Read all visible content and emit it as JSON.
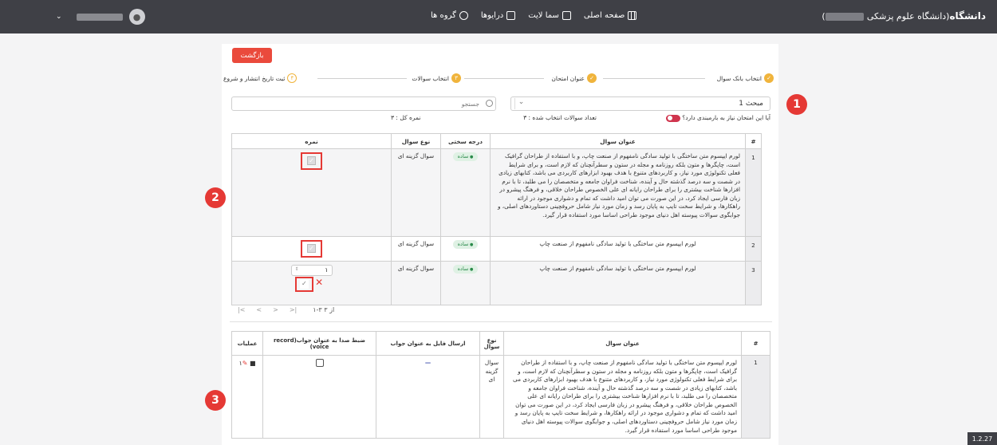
{
  "header": {
    "brand": "دانشگاه",
    "brand_sub": "(دانشگاه علوم پزشکی",
    "brand_close": ")",
    "nav": [
      {
        "label": "صفحه اصلی",
        "icon": "grid-icon"
      },
      {
        "label": "سما لایت",
        "icon": "file-icon"
      },
      {
        "label": "درایوها",
        "icon": "folder-icon"
      },
      {
        "label": "گروه ها",
        "icon": "people-icon"
      }
    ],
    "user_caret": "⌄"
  },
  "back_button": "بازگشت",
  "stepper": [
    {
      "label": "انتخاب بانک سوال",
      "state": "done"
    },
    {
      "label": "عنوان امتحان",
      "state": "done"
    },
    {
      "label": "انتخاب سوالات",
      "state": "current",
      "num": "۳"
    },
    {
      "label": "ثبت تاریخ انتشار و شروع",
      "state": "todo",
      "num": "۴"
    }
  ],
  "topic_select": {
    "value": "مبحث 1"
  },
  "search": {
    "placeholder": "جستجو"
  },
  "info": {
    "needs_scoring": "آیا این امتحان نیاز به بارمبندی دارد؟",
    "selected_count": "تعداد سوالات انتخاب شده : ۳",
    "total_score": "نمره کل : ۳"
  },
  "table1": {
    "headers": [
      "#",
      "عنوان سوال",
      "درجه سختی",
      "نوع سوال",
      "نمره"
    ],
    "rows": [
      {
        "num": "1",
        "title": "لورم ایپسوم متن ساختگی با تولید سادگی نامفهوم از صنعت چاپ، و با استفاده از طراحان گرافیک است، چاپگرها و متون بلکه روزنامه و مجله در ستون و سطرآنچنان که لازم است، و برای شرایط فعلی تکنولوژی مورد نیاز، و کاربردهای متنوع با هدف بهبود ابزارهای کاربردی می باشد، کتابهای زیادی در شصت و سه درصد گذشته حال و آینده، شناخت فراوان جامعه و متخصصان را می طلبد، تا با نرم افزارها شناخت بیشتری را برای طراحان رایانه ای علی الخصوص طراحان خلاقی، و فرهنگ پیشرو در زبان فارسی ایجاد کرد، در این صورت می توان امید داشت که تمام و دشواری موجود در ارائه راهکارها، و شرایط سخت تایپ به پایان رسد و زمان مورد نیاز شامل حروفچینی دستاوردهای اصلی، و جوابگوی سوالات پیوسته اهل دنیای موجود طراحی اساسا مورد استفاده قرار گیرد.",
        "difficulty": "ساده",
        "type": "سوال گزینه ای"
      },
      {
        "num": "2",
        "title": "لورم ایپسوم متن ساختگی با تولید سادگی نامفهوم از صنعت چاپ",
        "difficulty": "ساده",
        "type": "سوال گزینه ای"
      },
      {
        "num": "3",
        "title": "لورم ایپسوم متن ساختگی با تولید سادگی نامفهوم از صنعت چاپ",
        "difficulty": "ساده",
        "type": "سوال گزینه ای",
        "score": "۱"
      }
    ]
  },
  "pager": {
    "first": "|<",
    "prev": "<",
    "next": ">",
    "last": ">|",
    "count": "۱-۳ از ۳"
  },
  "table2": {
    "headers": [
      "#",
      "عنوان سوال",
      "نوع سوال",
      "ارسال فایل به عنوان جواب",
      "ضبط صدا به عنوان جواب(record voice)",
      "عملیات"
    ],
    "rows": [
      {
        "num": "1",
        "title": "لورم ایپسوم متن ساختگی با تولید سادگی نامفهوم از صنعت چاپ، و با استفاده از طراحان گرافیک است، چاپگرها و متون بلکه روزنامه و مجله در ستون و سطرآنچنان که لازم است، و برای شرایط فعلی تکنولوژی مورد نیاز، و کاربردهای متنوع با هدف بهبود ابزارهای کاربردی می باشد، کتابهای زیادی در شصت و سه درصد گذشته حال و آینده، شناخت فراوان جامعه و متخصصان را می طلبد، تا با نرم افزارها شناخت بیشتری را برای طراحان رایانه ای علی الخصوص طراحان خلاقی، و فرهنگ پیشرو در زبان فارسی ایجاد کرد، در این صورت می توان امید داشت که تمام و دشواری موجود در ارائه راهکارها، و شرایط سخت تایپ به پایان رسد و زمان مورد نیاز شامل حروفچینی دستاوردهای اصلی، و جوابگوی سوالات پیوسته اهل دنیای موجود طراحی اساسا مورد استفاده قرار گیرد.",
        "type": "سوال گزینه ای",
        "file": "—",
        "op_num": "۱"
      }
    ]
  },
  "markers": [
    "1",
    "2",
    "3"
  ],
  "version": "1.2.27",
  "colors": {
    "accent": "#f0b43c",
    "danger": "#e53935",
    "topbar": "#3f4046",
    "success": "#2a8a4a"
  }
}
